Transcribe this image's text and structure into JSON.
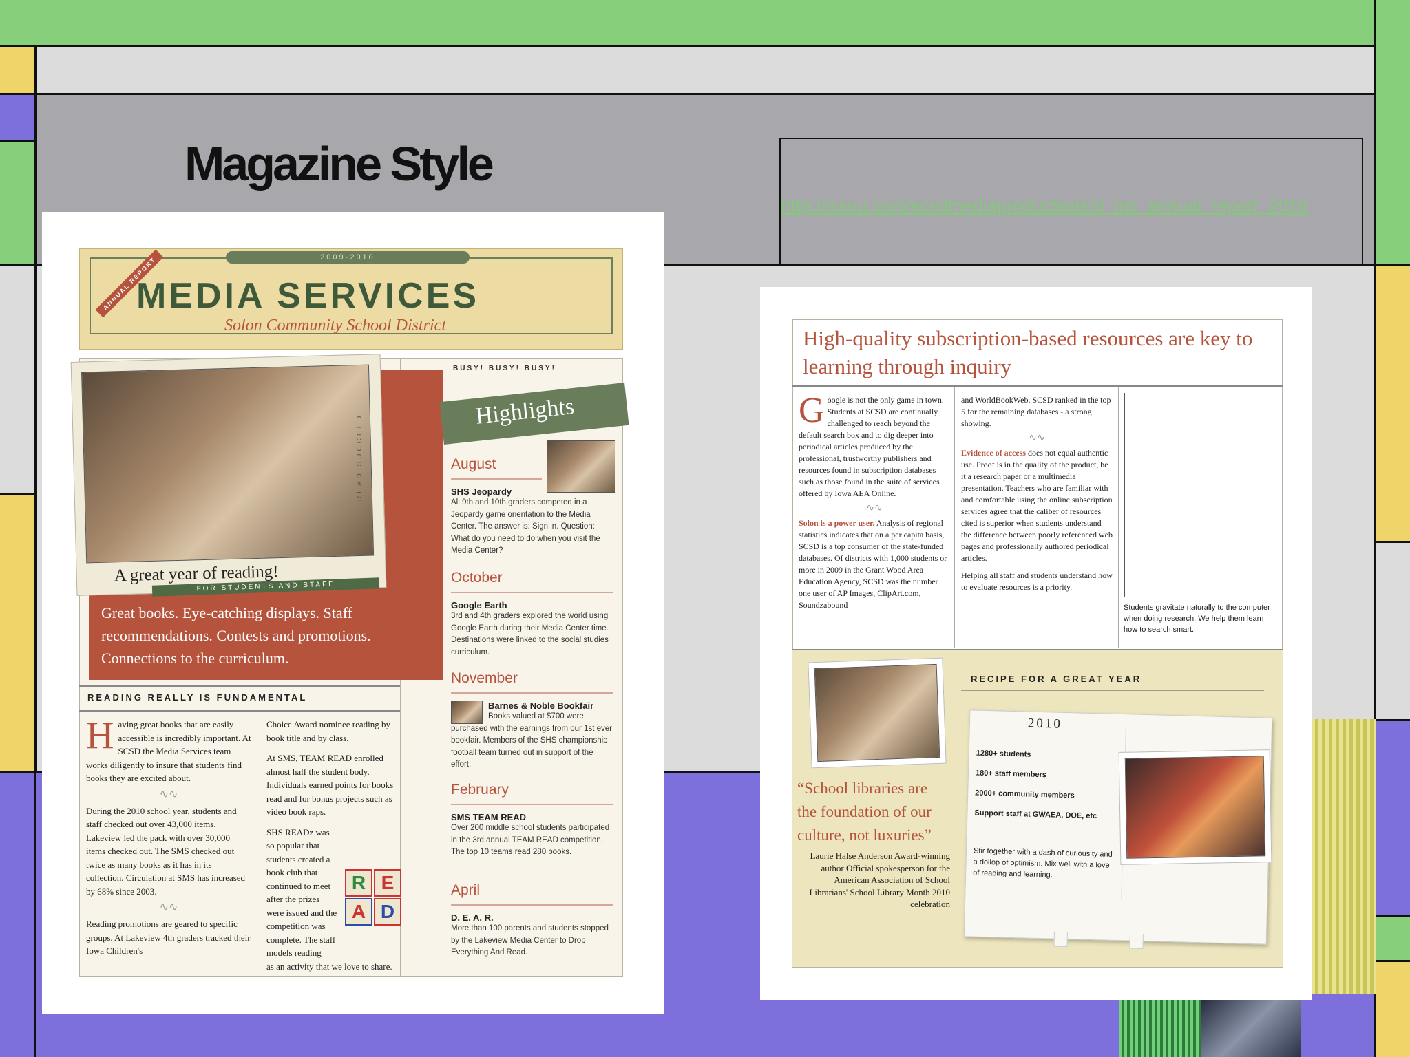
{
  "slide": {
    "title": "Magazine Style",
    "link": "http://issuu.com/scsdmediaproductions/d_mc_annual_report_2010"
  },
  "left": {
    "masthead": {
      "years": "2009-2010",
      "badge": "ANNUAL REPORT",
      "title": "MEDIA SERVICES",
      "subtitle": "Solon Community School District"
    },
    "photo_caption": "A great year of reading!",
    "photo_sub": "FOR STUDENTS AND STAFF",
    "side_text": "READ SUCCEED",
    "promo": "Great books. Eye-catching displays. Staff recommendations. Contests and promotions. Connections to the curriculum.",
    "busy": "BUSY! BUSY! BUSY!",
    "highlights": "Highlights",
    "events": [
      {
        "month": "August",
        "title": "SHS Jeopardy",
        "text": "All 9th and 10th graders competed in a Jeopardy game orientation to the Media Center. The answer is: Sign in. Question: What do you need to do when you visit the Media Center?"
      },
      {
        "month": "October",
        "title": "Google Earth",
        "text": "3rd and 4th graders explored the world using Google Earth during their Media Center time. Destinations were linked to the social studies curriculum."
      },
      {
        "month": "November",
        "title": "Barnes & Noble Bookfair",
        "text": "Books valued at $700 were purchased with the earnings from our 1st ever bookfair. Members of the SHS championship football team turned out in support of the effort."
      },
      {
        "month": "February",
        "title": "SMS TEAM READ",
        "text": "Over 200 middle school students participated in the 3rd annual TEAM READ competition. The top 10 teams read 280 books."
      },
      {
        "month": "April",
        "title": "D. E. A. R.",
        "text": "More than 100 parents and students stopped by the Lakeview Media Center to Drop Everything And Read."
      }
    ],
    "section_title": "READING REALLY IS FUNDAMENTAL",
    "drop_cap": "H",
    "col1_p1": "aving great books that are easily accessible is incredibly important. At SCSD the Media Services team works diligently to insure that students find books they are excited about.",
    "col1_p2": "During the 2010 school year, students and staff checked out over 43,000 items. Lakeview led the pack with over 30,000 items checked out. The SMS checked out twice as many books as it has in its collection. Circulation at SMS has increased by 68% since 2003.",
    "col1_p3": "Reading promotions are geared to specific groups. At Lakeview 4th graders tracked their Iowa Children's",
    "col2_p1": "Choice Award nominee reading by book title and by class.",
    "col2_p2": "At SMS, TEAM READ enrolled almost half the student body. Individuals earned points for books read and for bonus projects such as video book raps.",
    "col2_p3": "SHS READz was so popular that students created a book club that continued to meet after the prizes were issued and the competition was complete. The staff models reading",
    "col2_p4": "as an activity that we love to share.",
    "blocks": [
      "R",
      "E",
      "A",
      "D"
    ]
  },
  "right": {
    "headline": "High-quality subscription-based resources are key to learning through inquiry",
    "drop_cap": "G",
    "c1_p1": "oogle is not the only game in town. Students at SCSD are continually challenged to reach beyond the default search box and to dig deeper into periodical articles produced by the professional, trustworthy publishers and resources found in subscription databases such as those found in the suite of services offered by Iowa AEA Online.",
    "c1_lead": "Solon is a power user.",
    "c1_p2": " Analysis of regional statistics indicates that on a per capita basis, SCSD is a top consumer of the state-funded databases. Of districts with 1,000 students or more in 2009 in the Grant Wood Area Education Agency, SCSD was the number one user of AP Images, ClipArt.com, Soundzabound",
    "c2_p1": "and WorldBookWeb. SCSD ranked in the top 5 for the remaining databases - a strong showing.",
    "c2_lead": "Evidence of access",
    "c2_p2": " does not equal authentic use. Proof is in the quality of the product, be it a research paper or a multimedia presentation. Teachers who are familiar with and comfortable using the online subscription services agree that the caliber of resources cited is superior when students understand the difference between poorly referenced web pages and professionally authored periodical articles.",
    "c2_p3": "Helping all staff and students understand how to evaluate resources is a priority.",
    "photo_caption": "Students gravitate naturally to the computer when doing research. We help them learn how to search smart.",
    "quote": "“School libraries are the foundation of our culture, not luxuries”",
    "attribution": "Laurie Halse Anderson Award-winning author Official spokesperson for the American Association of School Librarians' School Library Month 2010 celebration",
    "recipe_title": "RECIPE FOR A GREAT YEAR",
    "card_year": "2010",
    "card_items": [
      "1280+ students",
      "180+ staff members",
      "2000+ community members",
      "Support staff at GWAEA, DOE, etc"
    ],
    "card_note": "Stir together with a dash of curiousity and a dollop of optimism. Mix well with a love of reading and learning."
  },
  "colors": {
    "accent": "#b5533d",
    "mast_green": "#4f6a45",
    "link": "#84c97a"
  }
}
